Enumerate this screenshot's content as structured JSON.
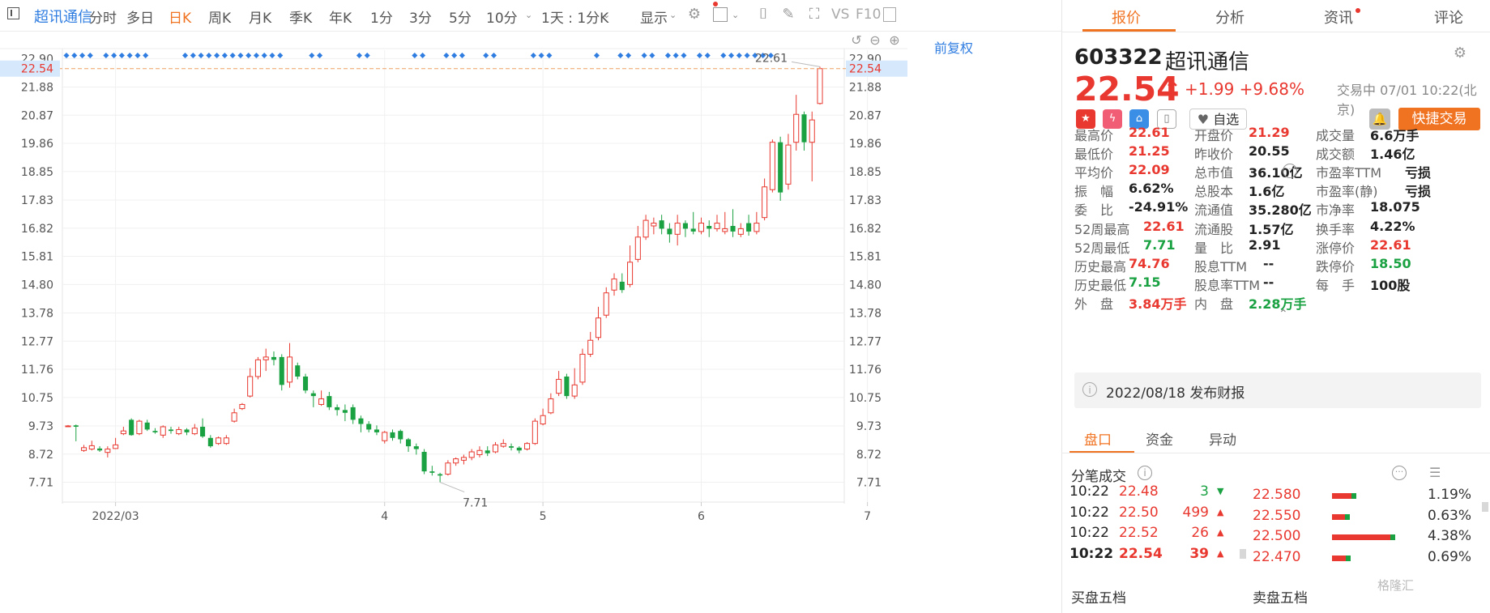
{
  "toolbar": {
    "stock_name": "超讯通信",
    "timeframes": [
      "分时",
      "多日",
      "日K",
      "周K",
      "月K",
      "季K",
      "年K",
      "1分",
      "3分",
      "5分",
      "10分"
    ],
    "active_timeframe": "日K",
    "range": "1天 : 1分K",
    "display": "显示",
    "vs_label": "VS",
    "f10_label": "F10"
  },
  "chart": {
    "adjust_label": "前复权",
    "last_price_label": "22.54",
    "high_annotation": "22.61",
    "low_annotation": "7.71"
  },
  "chart_data": {
    "type": "candlestick",
    "y_ticks": [
      22.9,
      21.88,
      20.87,
      19.86,
      18.85,
      17.83,
      16.82,
      15.81,
      14.8,
      13.78,
      12.77,
      11.76,
      10.75,
      9.73,
      8.72,
      7.71
    ],
    "ylim": [
      7.0,
      23.2
    ],
    "x_tick_labels": [
      "2022/03",
      "4",
      "5",
      "6",
      "7"
    ],
    "x_tick_index": [
      6,
      40,
      60,
      80,
      101
    ],
    "last_price": 22.54,
    "period_high": 22.61,
    "period_low": 7.71,
    "candles": [
      [
        9.73,
        9.73,
        9.76,
        9.7
      ],
      [
        9.75,
        9.7,
        9.78,
        9.18
      ],
      [
        8.85,
        8.95,
        9.05,
        8.8
      ],
      [
        8.9,
        9.02,
        9.2,
        8.85
      ],
      [
        8.92,
        8.85,
        9.0,
        8.8
      ],
      [
        8.78,
        8.9,
        9.0,
        8.6
      ],
      [
        8.92,
        9.05,
        9.3,
        8.9
      ],
      [
        9.45,
        9.55,
        9.7,
        9.4
      ],
      [
        9.95,
        9.4,
        10.0,
        9.38
      ],
      [
        9.45,
        9.9,
        9.95,
        9.4
      ],
      [
        9.85,
        9.6,
        9.95,
        9.55
      ],
      [
        9.55,
        9.5,
        9.65,
        9.45
      ],
      [
        9.4,
        9.7,
        9.75,
        9.3
      ],
      [
        9.6,
        9.55,
        9.7,
        9.45
      ],
      [
        9.45,
        9.6,
        9.7,
        9.4
      ],
      [
        9.6,
        9.5,
        9.65,
        9.4
      ],
      [
        9.45,
        9.65,
        9.8,
        9.4
      ],
      [
        9.7,
        9.35,
        10.0,
        9.3
      ],
      [
        9.3,
        9.0,
        9.4,
        8.95
      ],
      [
        9.1,
        9.3,
        9.35,
        9.05
      ],
      [
        9.1,
        9.3,
        9.4,
        9.05
      ],
      [
        9.9,
        10.2,
        10.35,
        9.85
      ],
      [
        10.35,
        10.5,
        10.55,
        10.3
      ],
      [
        10.8,
        11.5,
        11.8,
        10.75
      ],
      [
        11.5,
        12.1,
        12.2,
        11.4
      ],
      [
        12.1,
        12.2,
        12.5,
        11.7
      ],
      [
        12.2,
        12.1,
        12.4,
        11.9
      ],
      [
        12.2,
        11.2,
        12.3,
        11.0
      ],
      [
        11.3,
        12.2,
        12.7,
        11.1
      ],
      [
        11.9,
        11.5,
        12.0,
        11.4
      ],
      [
        11.5,
        11.0,
        11.6,
        10.9
      ],
      [
        10.9,
        10.8,
        11.0,
        10.4
      ],
      [
        10.5,
        10.7,
        11.0,
        10.45
      ],
      [
        10.8,
        10.4,
        10.95,
        10.3
      ],
      [
        10.4,
        10.3,
        10.5,
        10.1
      ],
      [
        10.3,
        10.2,
        10.5,
        9.9
      ],
      [
        10.4,
        9.95,
        10.5,
        9.8
      ],
      [
        10.0,
        9.8,
        10.1,
        9.5
      ],
      [
        9.8,
        9.6,
        9.9,
        9.5
      ],
      [
        9.6,
        9.5,
        9.75,
        9.4
      ],
      [
        9.2,
        9.5,
        9.55,
        9.1
      ],
      [
        9.5,
        9.3,
        9.6,
        9.2
      ],
      [
        9.55,
        9.25,
        9.6,
        9.1
      ],
      [
        9.25,
        9.0,
        9.3,
        8.8
      ],
      [
        9.0,
        8.9,
        9.1,
        8.7
      ],
      [
        8.8,
        8.1,
        8.9,
        8.0
      ],
      [
        8.1,
        8.05,
        8.3,
        7.95
      ],
      [
        8.0,
        7.95,
        8.05,
        7.71
      ],
      [
        8.0,
        8.4,
        8.5,
        7.95
      ],
      [
        8.4,
        8.55,
        8.6,
        8.3
      ],
      [
        8.5,
        8.6,
        8.7,
        8.35
      ],
      [
        8.6,
        8.8,
        8.9,
        8.5
      ],
      [
        8.7,
        8.85,
        9.0,
        8.6
      ],
      [
        8.85,
        8.75,
        9.0,
        8.65
      ],
      [
        8.8,
        9.05,
        9.15,
        8.75
      ],
      [
        9.0,
        9.1,
        9.25,
        8.95
      ],
      [
        9.0,
        8.95,
        9.1,
        8.85
      ],
      [
        8.95,
        8.85,
        9.0,
        8.75
      ],
      [
        8.9,
        9.1,
        9.15,
        8.85
      ],
      [
        9.1,
        9.9,
        10.0,
        9.05
      ],
      [
        9.8,
        10.1,
        10.35,
        9.75
      ],
      [
        10.2,
        10.7,
        10.9,
        10.15
      ],
      [
        10.9,
        11.4,
        11.7,
        10.8
      ],
      [
        11.5,
        10.8,
        11.6,
        10.7
      ],
      [
        10.8,
        11.2,
        11.8,
        10.7
      ],
      [
        11.3,
        12.3,
        12.5,
        11.2
      ],
      [
        12.3,
        12.8,
        13.1,
        12.2
      ],
      [
        12.9,
        13.6,
        14.0,
        12.8
      ],
      [
        13.7,
        14.5,
        14.7,
        13.6
      ],
      [
        14.6,
        15.0,
        15.2,
        14.4
      ],
      [
        14.9,
        14.6,
        15.2,
        14.5
      ],
      [
        14.8,
        15.6,
        16.2,
        14.7
      ],
      [
        15.7,
        16.5,
        16.9,
        15.6
      ],
      [
        16.5,
        17.1,
        17.3,
        16.4
      ],
      [
        16.9,
        17.0,
        17.2,
        16.6
      ],
      [
        17.1,
        16.8,
        17.3,
        16.6
      ],
      [
        16.8,
        16.6,
        17.0,
        16.3
      ],
      [
        16.6,
        17.0,
        17.3,
        16.2
      ],
      [
        17.0,
        16.8,
        17.1,
        16.5
      ],
      [
        16.8,
        16.7,
        17.4,
        16.6
      ],
      [
        16.7,
        17.0,
        17.2,
        16.6
      ],
      [
        16.9,
        16.8,
        17.1,
        16.5
      ],
      [
        16.8,
        17.0,
        17.3,
        16.7
      ],
      [
        16.7,
        16.8,
        17.4,
        16.6
      ],
      [
        16.9,
        16.7,
        17.5,
        16.5
      ],
      [
        16.6,
        16.8,
        17.0,
        16.5
      ],
      [
        17.0,
        16.7,
        17.3,
        16.55
      ],
      [
        16.7,
        17.0,
        17.4,
        16.6
      ],
      [
        17.2,
        18.3,
        18.6,
        17.1
      ],
      [
        18.2,
        19.9,
        20.0,
        18.1
      ],
      [
        19.9,
        18.1,
        20.1,
        17.8
      ],
      [
        18.4,
        19.8,
        20.2,
        18.2
      ],
      [
        19.9,
        20.9,
        21.6,
        19.6
      ],
      [
        20.9,
        19.9,
        21.0,
        19.6
      ],
      [
        19.9,
        20.7,
        21.0,
        18.5
      ],
      [
        21.29,
        22.54,
        22.61,
        21.25
      ]
    ]
  },
  "panel": {
    "tabs": [
      "报价",
      "分析",
      "资讯",
      "评论"
    ],
    "active_tab": "报价",
    "code": "603322",
    "name": "超讯通信",
    "price": "22.54",
    "change": "+1.99",
    "change_pct": "+9.68%",
    "status": "交易中 07/01 10:22(北京)",
    "zixuan": "自选",
    "quick_trade": "快捷交易",
    "quote_rows": [
      [
        [
          "最高价",
          "22.61",
          "red"
        ],
        [
          "开盘价",
          "21.29",
          "red"
        ],
        [
          "成交量",
          "6.6万手",
          "dark"
        ]
      ],
      [
        [
          "最低价",
          "21.25",
          "red"
        ],
        [
          "昨收价",
          "20.55",
          "dark"
        ],
        [
          "成交额",
          "1.46亿",
          "dark"
        ]
      ],
      [
        [
          "平均价",
          "22.09",
          "red"
        ],
        [
          "总市值",
          "36.10亿",
          "dark"
        ],
        [
          "市盈率TTM",
          "亏损",
          "dark"
        ]
      ],
      [
        [
          "振　幅",
          "6.62%",
          "dark"
        ],
        [
          "总股本",
          "1.6亿",
          "dark"
        ],
        [
          "市盈率(静)",
          "亏损",
          "dark"
        ]
      ],
      [
        [
          "委　比",
          "-24.91%",
          "dark"
        ],
        [
          "流通值",
          "35.280亿",
          "dark"
        ],
        [
          "市净率",
          "18.075",
          "dark"
        ]
      ],
      [
        [
          "52周最高",
          "22.61",
          "red"
        ],
        [
          "流通股",
          "1.57亿",
          "dark"
        ],
        [
          "换手率",
          "4.22%",
          "dark"
        ]
      ],
      [
        [
          "52周最低",
          "7.71",
          "green"
        ],
        [
          "量　比",
          "2.91",
          "dark"
        ],
        [
          "涨停价",
          "22.61",
          "red"
        ]
      ],
      [
        [
          "历史最高",
          "74.76",
          "red"
        ],
        [
          "股息TTM",
          "--",
          "dark"
        ],
        [
          "跌停价",
          "18.50",
          "green"
        ]
      ],
      [
        [
          "历史最低",
          "7.15",
          "green"
        ],
        [
          "股息率TTM",
          "--",
          "dark"
        ],
        [
          "每　手",
          "100股",
          "dark"
        ]
      ],
      [
        [
          "外　盘",
          "3.84万手",
          "red"
        ],
        [
          "内　盘",
          "2.28万手",
          "green"
        ],
        [
          "",
          "",
          "dark"
        ]
      ]
    ],
    "report": "2022/08/18  发布财报",
    "subtabs": [
      "盘口",
      "资金",
      "异动"
    ],
    "active_subtab": "盘口",
    "tick_title": "分笔成交",
    "ticks": [
      {
        "time": "10:22",
        "price": "22.48",
        "vol": "3",
        "dir": "down"
      },
      {
        "time": "10:22",
        "price": "22.50",
        "vol": "499",
        "dir": "up"
      },
      {
        "time": "10:22",
        "price": "22.52",
        "vol": "26",
        "dir": "up"
      },
      {
        "time": "10:22",
        "price": "22.54",
        "vol": "39",
        "dir": "up"
      }
    ],
    "levels": [
      {
        "price": "22.580",
        "pct": "1.19%",
        "share": 0.25
      },
      {
        "price": "22.550",
        "pct": "0.63%",
        "share": 0.13
      },
      {
        "price": "22.500",
        "pct": "4.38%",
        "share": 1.0
      },
      {
        "price": "22.470",
        "pct": "0.69%",
        "share": 0.14
      }
    ],
    "bid_title": "买盘五档",
    "ask_title": "卖盘五档",
    "watermark": "格隆汇"
  }
}
